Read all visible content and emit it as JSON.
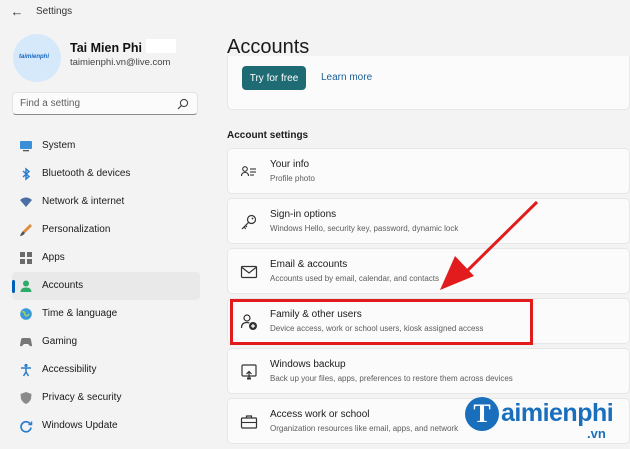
{
  "app": {
    "title": "Settings"
  },
  "user": {
    "name": "Tai Mien Phi",
    "email": "taimienphi.vn@live.com",
    "avatar_logo": "taimienphi"
  },
  "search": {
    "placeholder": "Find a setting"
  },
  "sidebar": {
    "items": [
      {
        "label": "System",
        "icon": "monitor-icon"
      },
      {
        "label": "Bluetooth & devices",
        "icon": "bluetooth-icon"
      },
      {
        "label": "Network & internet",
        "icon": "wifi-icon"
      },
      {
        "label": "Personalization",
        "icon": "brush-icon"
      },
      {
        "label": "Apps",
        "icon": "apps-icon"
      },
      {
        "label": "Accounts",
        "icon": "person-icon",
        "active": true
      },
      {
        "label": "Time & language",
        "icon": "globe-icon"
      },
      {
        "label": "Gaming",
        "icon": "gamepad-icon"
      },
      {
        "label": "Accessibility",
        "icon": "accessibility-icon"
      },
      {
        "label": "Privacy & security",
        "icon": "shield-icon"
      },
      {
        "label": "Windows Update",
        "icon": "update-icon"
      }
    ]
  },
  "main": {
    "title": "Accounts",
    "promo": {
      "try_label": "Try for free",
      "learn_label": "Learn more"
    },
    "section_title": "Account settings",
    "cards": [
      {
        "title": "Your info",
        "desc": "Profile photo",
        "icon": "contact-card-icon"
      },
      {
        "title": "Sign-in options",
        "desc": "Windows Hello, security key, password, dynamic lock",
        "icon": "key-icon"
      },
      {
        "title": "Email & accounts",
        "desc": "Accounts used by email, calendar, and contacts",
        "icon": "mail-icon"
      },
      {
        "title": "Family & other users",
        "desc": "Device access, work or school users, kiosk assigned access",
        "icon": "person-add-icon",
        "highlighted": true
      },
      {
        "title": "Windows backup",
        "desc": "Back up your files, apps, preferences to restore them across devices",
        "icon": "backup-icon"
      },
      {
        "title": "Access work or school",
        "desc": "Organization resources like email, apps, and network",
        "icon": "briefcase-icon"
      }
    ]
  },
  "colors": {
    "accent": "#005fb8",
    "button": "#1f6b73",
    "annotation": "#e21c1c",
    "watermark": "#1a6fbd"
  },
  "watermark": {
    "main": "aimienphi",
    "initial": "T",
    "suffix": ".vn"
  }
}
